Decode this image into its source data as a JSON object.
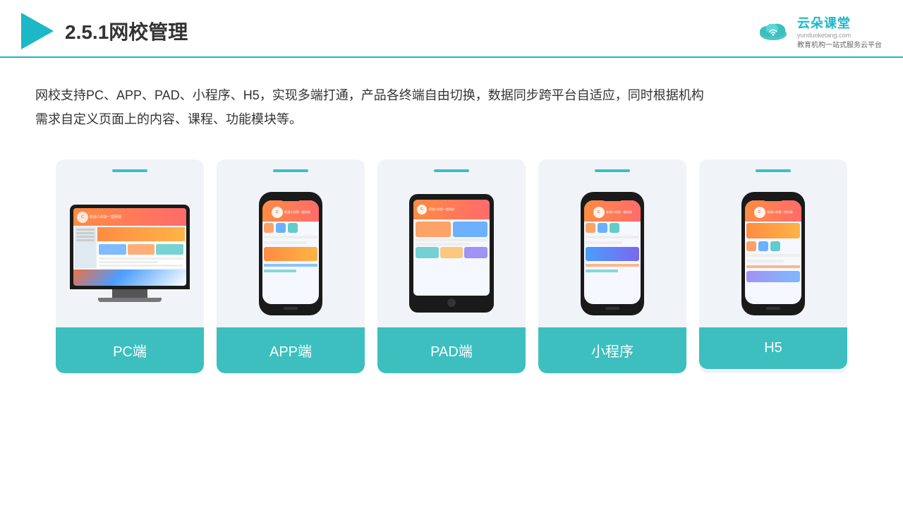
{
  "header": {
    "title": "2.5.1网校管理",
    "brand": {
      "name": "云朵课堂",
      "url": "yunduoketang.com",
      "slogan": "教育机构一站",
      "slogan2": "式服务云平台"
    }
  },
  "description": "网校支持PC、APP、PAD、小程序、H5，实现多端打通，产品各终端自由切换，数据同步跨平台自适应，同时根据机构\n需求自定义页面上的内容、课程、功能模块等。",
  "cards": [
    {
      "label": "PC端",
      "type": "pc"
    },
    {
      "label": "APP端",
      "type": "phone"
    },
    {
      "label": "PAD端",
      "type": "tablet"
    },
    {
      "label": "小程序",
      "type": "phone"
    },
    {
      "label": "H5",
      "type": "phone"
    }
  ],
  "colors": {
    "accent": "#3dbfbf",
    "dark": "#1a1a1a",
    "light_bg": "#f0f4f8"
  }
}
